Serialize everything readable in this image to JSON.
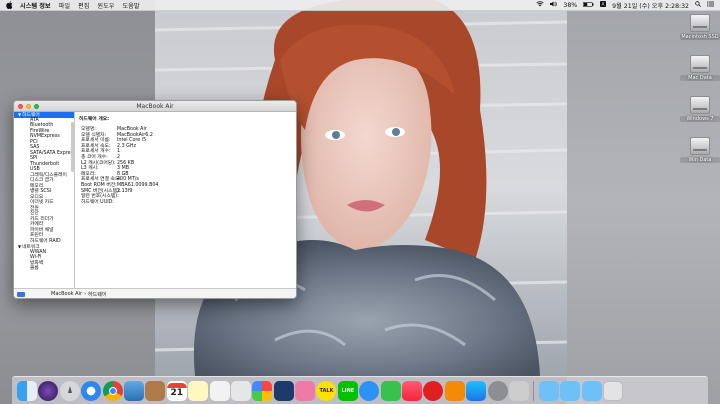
{
  "menubar": {
    "app_name": "시스템 정보",
    "menus": [
      "파일",
      "편집",
      "윈도우",
      "도움말"
    ],
    "battery": "38%",
    "datetime": "9월 21일 (수) 오후 2:28:32"
  },
  "desktop": {
    "drives": [
      "Macintosh SSD",
      "Mac Data",
      "Windows 7",
      "Win Data"
    ]
  },
  "window": {
    "title": "MacBook Air",
    "sidebar": {
      "hardware_group": "하드웨어",
      "hardware_items": [
        "ATA",
        "Bluetooth",
        "FireWire",
        "NVMExpress",
        "PCI",
        "SAS",
        "SATA/SATA Express",
        "SPI",
        "Thunderbolt",
        "USB",
        "그래픽/디스플레이",
        "디스크 굽기",
        "메모리",
        "병렬 SCSI",
        "오디오",
        "이더넷 카드",
        "전원",
        "진단",
        "카드 리더기",
        "카메라",
        "파이버 채널",
        "프린터",
        "하드웨어 RAID"
      ],
      "network_group": "네트워크",
      "network_items": [
        "WWAN",
        "Wi-Fi",
        "방화벽",
        "볼륨"
      ]
    },
    "main": {
      "header": "하드웨어 개요:",
      "rows": [
        {
          "k": "모델명:",
          "v": "MacBook Air"
        },
        {
          "k": "모델 식별자:",
          "v": "MacBookAir6,2"
        },
        {
          "k": "프로세서 이름:",
          "v": "Intel Core i5"
        },
        {
          "k": "프로세서 속도:",
          "v": "2.3 GHz"
        },
        {
          "k": "프로세서 개수:",
          "v": "1"
        },
        {
          "k": "총 코어 개수:",
          "v": "2"
        },
        {
          "k": "L2 캐시(코어당):",
          "v": "256 KB"
        },
        {
          "k": "L3 캐시:",
          "v": "3 MB"
        },
        {
          "k": "메모리:",
          "v": "8 GB"
        },
        {
          "k": "프로세서 연결 속도:",
          "v": "400 MT/s"
        },
        {
          "k": "Boot ROM 버전:",
          "v": "MBA61.0099.B04"
        },
        {
          "k": "SMC 버전(시스템):",
          "v": "2.13f9"
        },
        {
          "k": "일련 번호(시스템):",
          "v": ""
        },
        {
          "k": "하드웨어 UUID:",
          "v": ""
        }
      ]
    },
    "pathbar": {
      "machine": "MacBook Air",
      "section": "하드웨어"
    }
  },
  "dock": {
    "calendar_day": "21",
    "talk_label": "TALK",
    "line_label": "LINE"
  }
}
